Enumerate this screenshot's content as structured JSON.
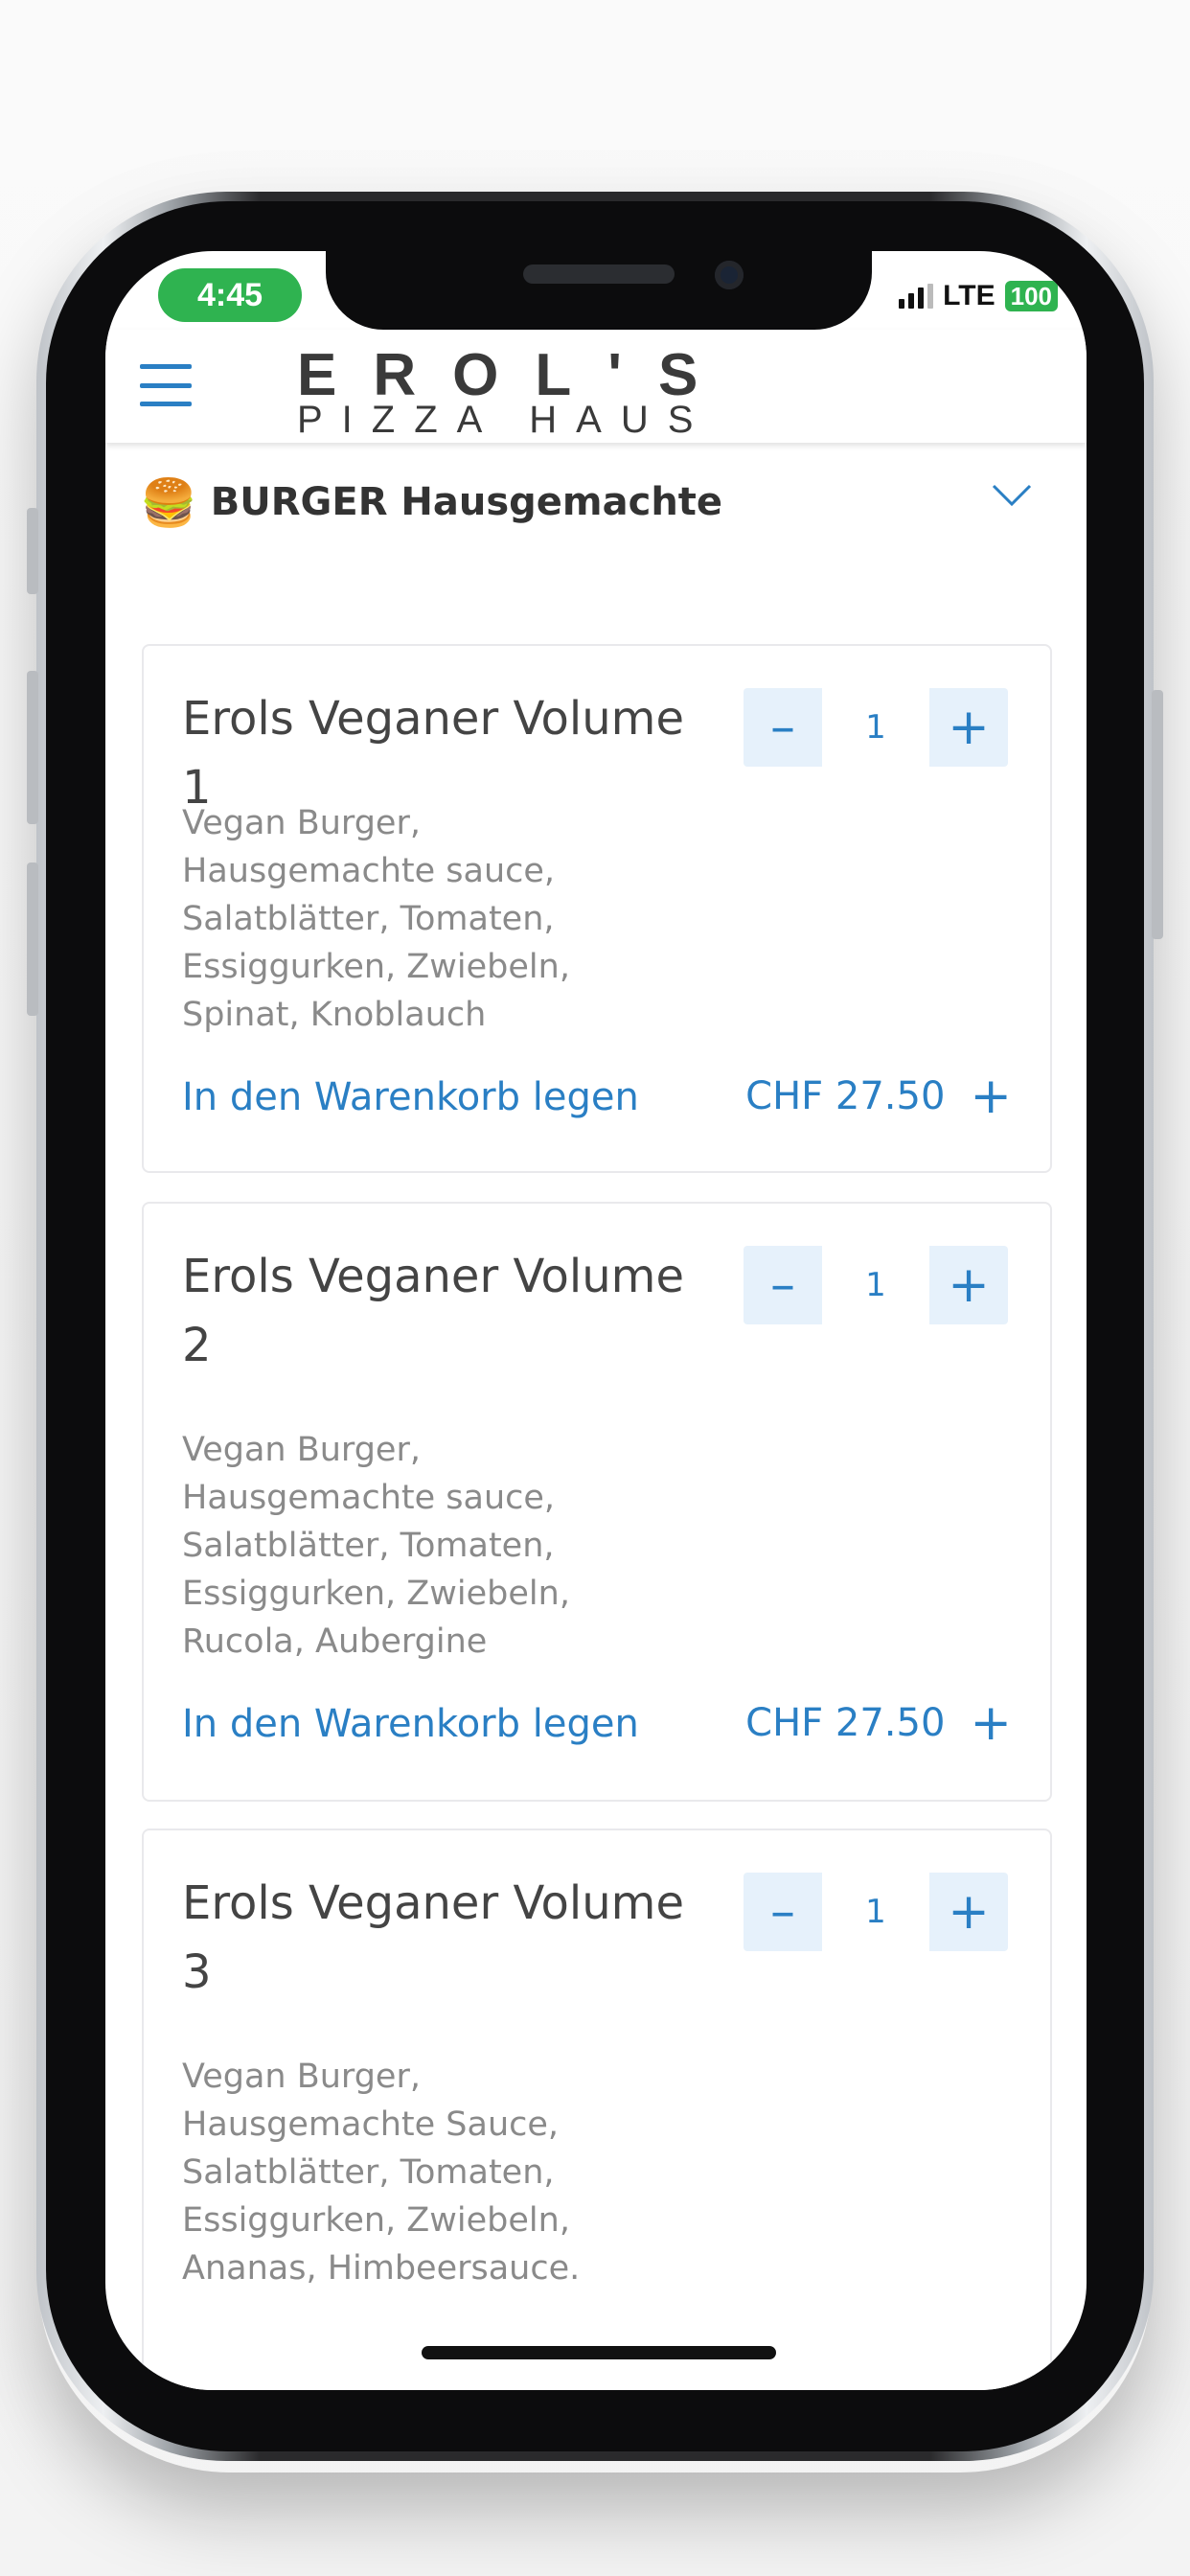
{
  "status_bar": {
    "time": "4:45",
    "network": "LTE",
    "battery": "100"
  },
  "header": {
    "logo_top": "EROL'S",
    "logo_bottom": "PIZZA HAUS"
  },
  "category": {
    "emoji": "🍔",
    "title": "BURGER Hausgemachte"
  },
  "items": [
    {
      "name": "Erols Veganer Volume 1",
      "description": "Vegan Burger, Hausgemachte sauce, Salatblätter, Tomaten, Essiggurken, Zwiebeln,  Spinat, Knoblauch",
      "quantity": "1",
      "minus": "–",
      "plus": "+",
      "add_to_cart": "In den Warenkorb legen",
      "price": "CHF 27.50",
      "price_plus": "+"
    },
    {
      "name": "Erols Veganer Volume 2",
      "description": "Vegan Burger, Hausgemachte sauce, Salatblätter, Tomaten, Essiggurken, Zwiebeln,  Rucola, Aubergine",
      "quantity": "1",
      "minus": "–",
      "plus": "+",
      "add_to_cart": "In den Warenkorb legen",
      "price": "CHF 27.50",
      "price_plus": "+"
    },
    {
      "name": "Erols Veganer Volume 3",
      "description": "Vegan Burger, Hausgemachte Sauce, Salatblätter, Tomaten, Essiggurken, Zwiebeln,  Ananas, Himbeersauce.",
      "quantity": "1",
      "minus": "–",
      "plus": "+"
    }
  ],
  "colors": {
    "accent": "#2a7fc4",
    "status_green": "#2fb350",
    "qty_bg": "#e6f1fb"
  },
  "icons": {
    "menu": "hamburger-menu-icon",
    "expand": "chevron-down-icon"
  }
}
